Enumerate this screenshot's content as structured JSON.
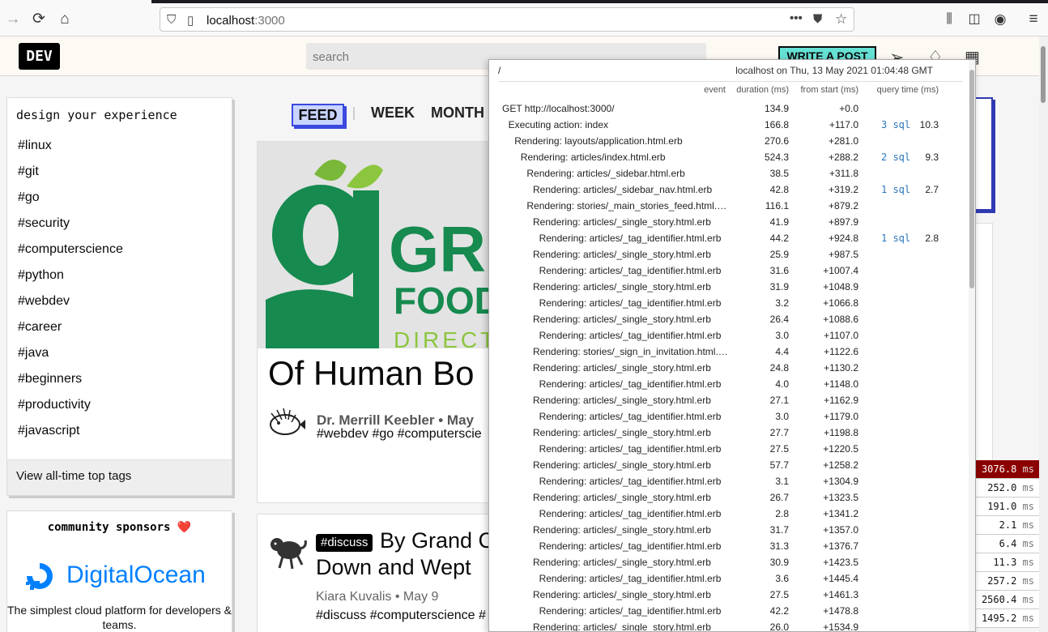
{
  "browser": {
    "url_host": "localhost",
    "url_port": ":3000"
  },
  "header": {
    "logo": "DEV",
    "search_placeholder": "search",
    "write_post": "WRITE A POST"
  },
  "sidebar": {
    "heading": "design your experience",
    "tags": [
      "#linux",
      "#git",
      "#go",
      "#security",
      "#computerscience",
      "#python",
      "#webdev",
      "#career",
      "#java",
      "#beginners",
      "#productivity",
      "#javascript"
    ],
    "top_tags_link": "View all-time top tags"
  },
  "sponsor": {
    "heading": "community sponsors ❤️",
    "brand": "DigitalOcean",
    "description": "The simplest cloud platform for developers & teams."
  },
  "feed": {
    "tabs": [
      "FEED",
      "WEEK",
      "MONTH"
    ]
  },
  "article1": {
    "title": "Of Human Bo",
    "author": "Dr. Merrill Keebler",
    "date_prefix": "• May",
    "tags": "#webdev  #go  #computerscie"
  },
  "article2": {
    "badge": "#discuss",
    "title_line1": "By Grand C",
    "title_line2": "Down and Wept",
    "author": "Kiara Kuvalis",
    "date": "• May 9",
    "tags": "#discuss  #computerscience  #"
  },
  "mini_profiler": [
    {
      "value": "3076.8",
      "unit": "ms",
      "hot": true
    },
    {
      "value": "252.0",
      "unit": "ms"
    },
    {
      "value": "191.0",
      "unit": "ms"
    },
    {
      "value": "2.1",
      "unit": "ms"
    },
    {
      "value": "6.4",
      "unit": "ms"
    },
    {
      "value": "11.3",
      "unit": "ms"
    },
    {
      "value": "257.2",
      "unit": "ms"
    },
    {
      "value": "2560.4",
      "unit": "ms"
    },
    {
      "value": "1495.2",
      "unit": "ms"
    }
  ],
  "profiler": {
    "path": "/",
    "machine": "localhost on Thu, 13 May 2021 01:04:48 GMT",
    "columns": [
      "event",
      "duration (ms)",
      "from start (ms)",
      "query time (ms)"
    ],
    "rows": [
      {
        "name": "GET http://localhost:3000/",
        "indent": 0,
        "duration": "134.9",
        "start": "+0.0",
        "sql": "",
        "qt": ""
      },
      {
        "name": "Executing action: index",
        "indent": 1,
        "duration": "166.8",
        "start": "+117.0",
        "sql": "3 sql",
        "qt": "10.3"
      },
      {
        "name": "Rendering: layouts/application.html.erb",
        "indent": 2,
        "duration": "270.6",
        "start": "+281.0",
        "sql": "",
        "qt": ""
      },
      {
        "name": "Rendering: articles/index.html.erb",
        "indent": 3,
        "duration": "524.3",
        "start": "+288.2",
        "sql": "2 sql",
        "qt": "9.3"
      },
      {
        "name": "Rendering: articles/_sidebar.html.erb",
        "indent": 4,
        "duration": "38.5",
        "start": "+311.8",
        "sql": "",
        "qt": ""
      },
      {
        "name": "Rendering: articles/_sidebar_nav.html.erb",
        "indent": 5,
        "duration": "42.8",
        "start": "+319.2",
        "sql": "1 sql",
        "qt": "2.7"
      },
      {
        "name": "Rendering: stories/_main_stories_feed.html.erb",
        "indent": 4,
        "duration": "116.1",
        "start": "+879.2",
        "sql": "",
        "qt": ""
      },
      {
        "name": "Rendering: articles/_single_story.html.erb",
        "indent": 5,
        "duration": "41.9",
        "start": "+897.9",
        "sql": "",
        "qt": ""
      },
      {
        "name": "Rendering: articles/_tag_identifier.html.erb",
        "indent": 6,
        "duration": "44.2",
        "start": "+924.8",
        "sql": "1 sql",
        "qt": "2.8"
      },
      {
        "name": "Rendering: articles/_single_story.html.erb",
        "indent": 5,
        "duration": "25.9",
        "start": "+987.5",
        "sql": "",
        "qt": ""
      },
      {
        "name": "Rendering: articles/_tag_identifier.html.erb",
        "indent": 6,
        "duration": "31.6",
        "start": "+1007.4",
        "sql": "",
        "qt": ""
      },
      {
        "name": "Rendering: articles/_single_story.html.erb",
        "indent": 5,
        "duration": "31.9",
        "start": "+1048.9",
        "sql": "",
        "qt": ""
      },
      {
        "name": "Rendering: articles/_tag_identifier.html.erb",
        "indent": 6,
        "duration": "3.2",
        "start": "+1066.8",
        "sql": "",
        "qt": ""
      },
      {
        "name": "Rendering: articles/_single_story.html.erb",
        "indent": 5,
        "duration": "26.4",
        "start": "+1088.6",
        "sql": "",
        "qt": ""
      },
      {
        "name": "Rendering: articles/_tag_identifier.html.erb",
        "indent": 6,
        "duration": "3.0",
        "start": "+1107.0",
        "sql": "",
        "qt": ""
      },
      {
        "name": "Rendering: stories/_sign_in_invitation.html.erb",
        "indent": 5,
        "duration": "4.4",
        "start": "+1122.6",
        "sql": "",
        "qt": ""
      },
      {
        "name": "Rendering: articles/_single_story.html.erb",
        "indent": 5,
        "duration": "24.8",
        "start": "+1130.2",
        "sql": "",
        "qt": ""
      },
      {
        "name": "Rendering: articles/_tag_identifier.html.erb",
        "indent": 6,
        "duration": "4.0",
        "start": "+1148.0",
        "sql": "",
        "qt": ""
      },
      {
        "name": "Rendering: articles/_single_story.html.erb",
        "indent": 5,
        "duration": "27.1",
        "start": "+1162.9",
        "sql": "",
        "qt": ""
      },
      {
        "name": "Rendering: articles/_tag_identifier.html.erb",
        "indent": 6,
        "duration": "3.0",
        "start": "+1179.0",
        "sql": "",
        "qt": ""
      },
      {
        "name": "Rendering: articles/_single_story.html.erb",
        "indent": 5,
        "duration": "27.7",
        "start": "+1198.8",
        "sql": "",
        "qt": ""
      },
      {
        "name": "Rendering: articles/_tag_identifier.html.erb",
        "indent": 6,
        "duration": "27.5",
        "start": "+1220.5",
        "sql": "",
        "qt": ""
      },
      {
        "name": "Rendering: articles/_single_story.html.erb",
        "indent": 5,
        "duration": "57.7",
        "start": "+1258.2",
        "sql": "",
        "qt": ""
      },
      {
        "name": "Rendering: articles/_tag_identifier.html.erb",
        "indent": 6,
        "duration": "3.1",
        "start": "+1304.9",
        "sql": "",
        "qt": ""
      },
      {
        "name": "Rendering: articles/_single_story.html.erb",
        "indent": 5,
        "duration": "26.7",
        "start": "+1323.5",
        "sql": "",
        "qt": ""
      },
      {
        "name": "Rendering: articles/_tag_identifier.html.erb",
        "indent": 6,
        "duration": "2.8",
        "start": "+1341.2",
        "sql": "",
        "qt": ""
      },
      {
        "name": "Rendering: articles/_single_story.html.erb",
        "indent": 5,
        "duration": "31.7",
        "start": "+1357.0",
        "sql": "",
        "qt": ""
      },
      {
        "name": "Rendering: articles/_tag_identifier.html.erb",
        "indent": 6,
        "duration": "31.3",
        "start": "+1376.7",
        "sql": "",
        "qt": ""
      },
      {
        "name": "Rendering: articles/_single_story.html.erb",
        "indent": 5,
        "duration": "30.9",
        "start": "+1423.5",
        "sql": "",
        "qt": ""
      },
      {
        "name": "Rendering: articles/_tag_identifier.html.erb",
        "indent": 6,
        "duration": "3.6",
        "start": "+1445.4",
        "sql": "",
        "qt": ""
      },
      {
        "name": "Rendering: articles/_single_story.html.erb",
        "indent": 5,
        "duration": "27.5",
        "start": "+1461.3",
        "sql": "",
        "qt": ""
      },
      {
        "name": "Rendering: articles/_tag_identifier.html.erb",
        "indent": 6,
        "duration": "42.2",
        "start": "+1478.8",
        "sql": "",
        "qt": ""
      },
      {
        "name": "Rendering: articles/_single_story.html.erb",
        "indent": 5,
        "duration": "26.0",
        "start": "+1534.9",
        "sql": "",
        "qt": ""
      }
    ]
  }
}
